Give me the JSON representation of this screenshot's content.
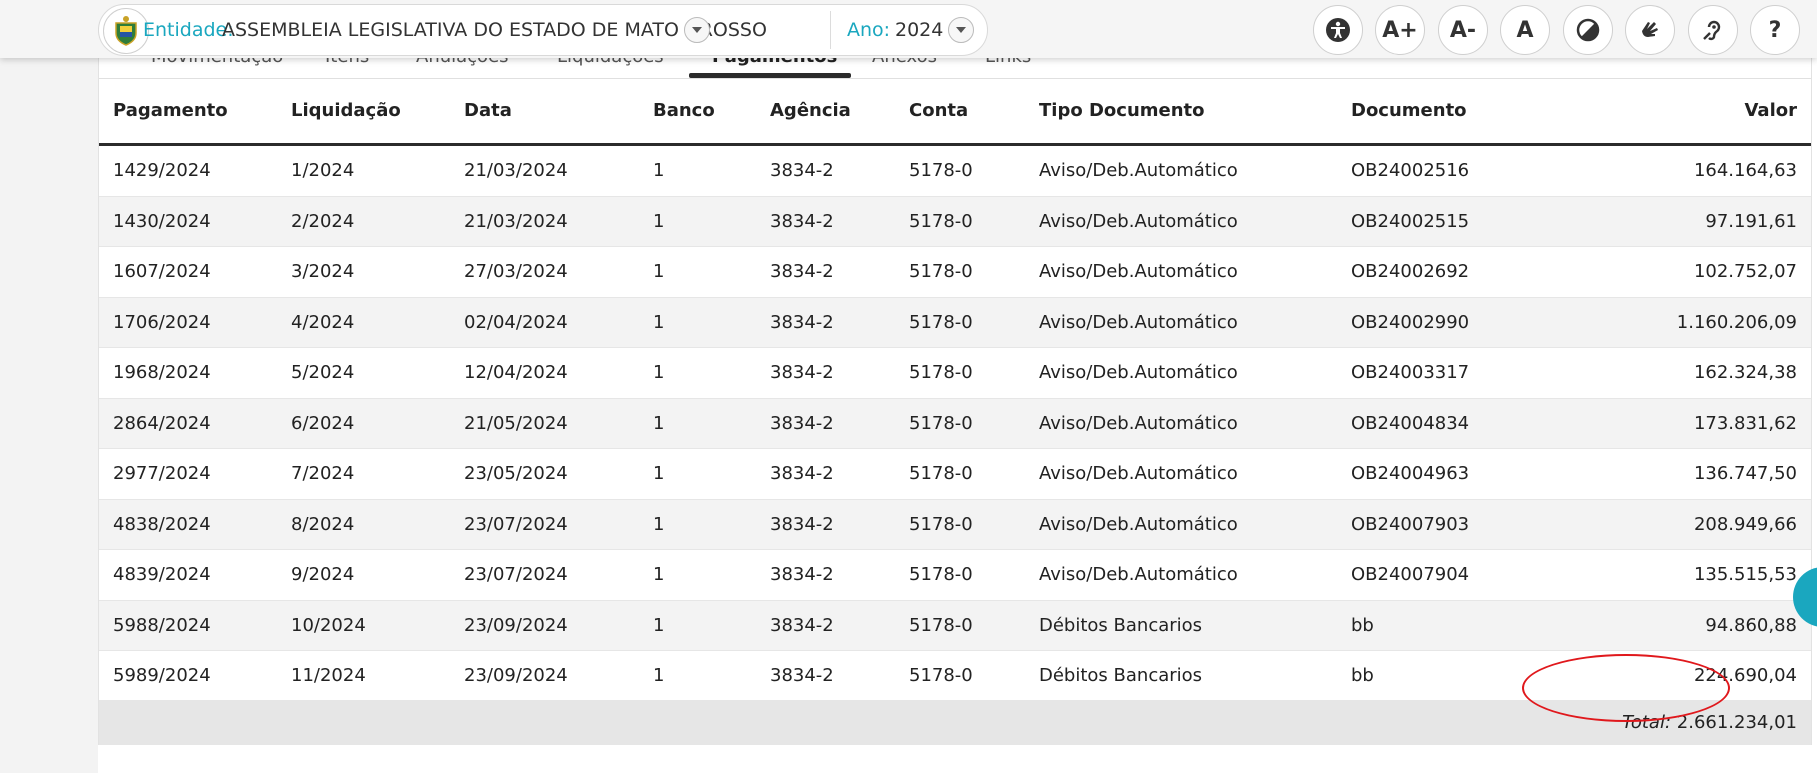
{
  "header": {
    "entity_label": "Entidade:",
    "entity_value": "ASSEMBLEIA LEGISLATIVA DO ESTADO DE MATO GROSSO",
    "year_label": "Ano:",
    "year_value": "2024",
    "accent_color": "#1aa7bf",
    "accessibility_buttons": [
      {
        "name": "accessibility-icon",
        "label": ""
      },
      {
        "name": "font-increase-button",
        "label": "A+"
      },
      {
        "name": "font-decrease-button",
        "label": "A-"
      },
      {
        "name": "font-reset-button",
        "label": "A"
      },
      {
        "name": "contrast-icon",
        "label": ""
      },
      {
        "name": "sign-language-icon",
        "label": ""
      },
      {
        "name": "hearing-icon",
        "label": ""
      },
      {
        "name": "help-button",
        "label": "?"
      }
    ]
  },
  "tabs": [
    "Movimentação",
    "Itens",
    "Anulações",
    "Liquidações",
    "Pagamentos",
    "Anexos",
    "Links"
  ],
  "table": {
    "columns": [
      "Pagamento",
      "Liquidação",
      "Data",
      "Banco",
      "Agência",
      "Conta",
      "Tipo Documento",
      "Documento",
      "Valor"
    ],
    "rows": [
      [
        "1429/2024",
        "1/2024",
        "21/03/2024",
        "1",
        "3834-2",
        "5178-0",
        "Aviso/Deb.Automático",
        "OB24002516",
        "164.164,63"
      ],
      [
        "1430/2024",
        "2/2024",
        "21/03/2024",
        "1",
        "3834-2",
        "5178-0",
        "Aviso/Deb.Automático",
        "OB24002515",
        "97.191,61"
      ],
      [
        "1607/2024",
        "3/2024",
        "27/03/2024",
        "1",
        "3834-2",
        "5178-0",
        "Aviso/Deb.Automático",
        "OB24002692",
        "102.752,07"
      ],
      [
        "1706/2024",
        "4/2024",
        "02/04/2024",
        "1",
        "3834-2",
        "5178-0",
        "Aviso/Deb.Automático",
        "OB24002990",
        "1.160.206,09"
      ],
      [
        "1968/2024",
        "5/2024",
        "12/04/2024",
        "1",
        "3834-2",
        "5178-0",
        "Aviso/Deb.Automático",
        "OB24003317",
        "162.324,38"
      ],
      [
        "2864/2024",
        "6/2024",
        "21/05/2024",
        "1",
        "3834-2",
        "5178-0",
        "Aviso/Deb.Automático",
        "OB24004834",
        "173.831,62"
      ],
      [
        "2977/2024",
        "7/2024",
        "23/05/2024",
        "1",
        "3834-2",
        "5178-0",
        "Aviso/Deb.Automático",
        "OB24004963",
        "136.747,50"
      ],
      [
        "4838/2024",
        "8/2024",
        "23/07/2024",
        "1",
        "3834-2",
        "5178-0",
        "Aviso/Deb.Automático",
        "OB24007903",
        "208.949,66"
      ],
      [
        "4839/2024",
        "9/2024",
        "23/07/2024",
        "1",
        "3834-2",
        "5178-0",
        "Aviso/Deb.Automático",
        "OB24007904",
        "135.515,53"
      ],
      [
        "5988/2024",
        "10/2024",
        "23/09/2024",
        "1",
        "3834-2",
        "5178-0",
        "Débitos Bancarios",
        "bb",
        "94.860,88"
      ],
      [
        "5989/2024",
        "11/2024",
        "23/09/2024",
        "1",
        "3834-2",
        "5178-0",
        "Débitos Bancarios",
        "bb",
        "224.690,04"
      ]
    ],
    "total_label": "Total:",
    "total_value": "2.661.234,01"
  },
  "highlight_color": "#e0181c"
}
